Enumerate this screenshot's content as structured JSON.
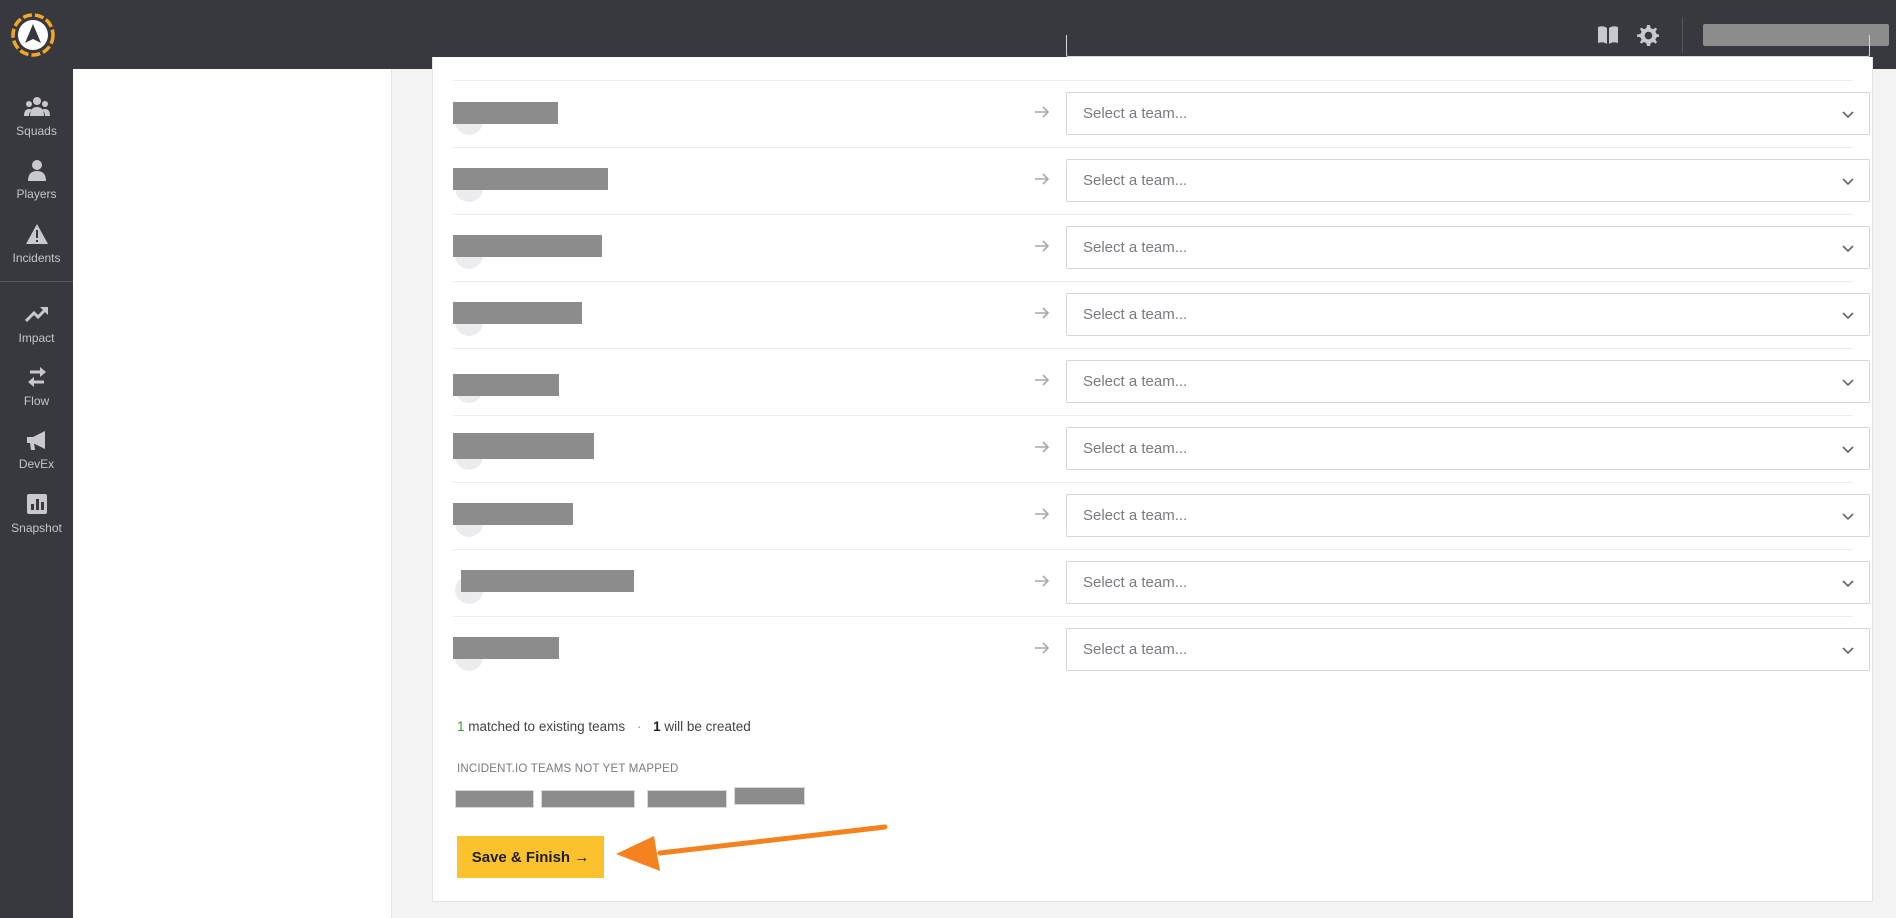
{
  "header": {
    "logo_icon": "compass-logo-icon",
    "docs_icon": "book-icon",
    "settings_icon": "gear-icon"
  },
  "nav": {
    "items": [
      {
        "label": "Squads",
        "icon": "squads-icon"
      },
      {
        "label": "Players",
        "icon": "person-icon"
      },
      {
        "label": "Incidents",
        "icon": "warning-icon"
      },
      {
        "label": "Impact",
        "icon": "trend-icon"
      },
      {
        "label": "Flow",
        "icon": "swap-arrows-icon"
      },
      {
        "label": "DevEx",
        "icon": "megaphone-icon"
      },
      {
        "label": "Snapshot",
        "icon": "bar-chart-icon"
      }
    ]
  },
  "mapping": {
    "select_placeholder": "Select a team...",
    "rows": [
      {
        "select": "Select a team..."
      },
      {
        "select": "Select a team..."
      },
      {
        "select": "Select a team..."
      },
      {
        "select": "Select a team..."
      },
      {
        "select": "Select a team..."
      },
      {
        "select": "Select a team..."
      },
      {
        "select": "Select a team..."
      },
      {
        "select": "Select a team..."
      },
      {
        "select": "Select a team..."
      }
    ]
  },
  "summary": {
    "matched_count": "1",
    "matched_text": "matched to existing teams",
    "separator": "·",
    "created_count": "1",
    "created_text": "will be created"
  },
  "unmapped": {
    "label": "INCIDENT.IO TEAMS NOT YET MAPPED"
  },
  "actions": {
    "save_label": "Save & Finish →"
  },
  "colors": {
    "sidebar": "#38383f",
    "accent": "#fcc22d",
    "annotation_arrow": "#f5821f",
    "matched_green": "#3e9a3b"
  }
}
